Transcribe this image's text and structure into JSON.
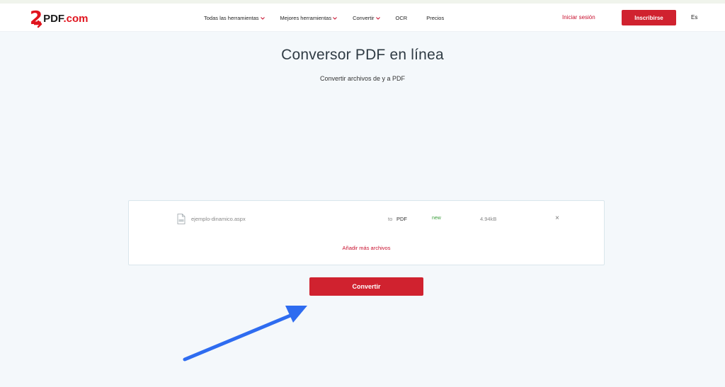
{
  "brand": {
    "logo_digit": "2",
    "logo_word": "PDF",
    "logo_suffix": ".com",
    "accent_color": "#d0222f"
  },
  "nav": {
    "items": [
      {
        "label": "Todas las herramientas",
        "has_dropdown": true
      },
      {
        "label": "Mejores herramientas",
        "has_dropdown": true
      },
      {
        "label": "Convertir",
        "has_dropdown": true
      },
      {
        "label": "OCR",
        "has_dropdown": false
      },
      {
        "label": "Precios",
        "has_dropdown": false
      }
    ],
    "login_label": "Iniciar sesión",
    "signup_label": "Inscribirse",
    "language_label": "Es"
  },
  "main": {
    "title": "Conversor PDF en línea",
    "subtitle": "Convertir archivos de y a PDF"
  },
  "files": [
    {
      "icon": "file-icon",
      "name": "ejemplo-dinamico.aspx",
      "to_label": "to",
      "target_format": "PDF",
      "status": "new",
      "size": "4.94kB",
      "remove_icon": "close-icon",
      "remove_glyph": "×"
    }
  ],
  "add_more_label": "Añadir más archivos",
  "convert_label": "Convertir",
  "annotation": {
    "icon": "pointer-arrow-icon",
    "color": "#2e6cf0"
  }
}
